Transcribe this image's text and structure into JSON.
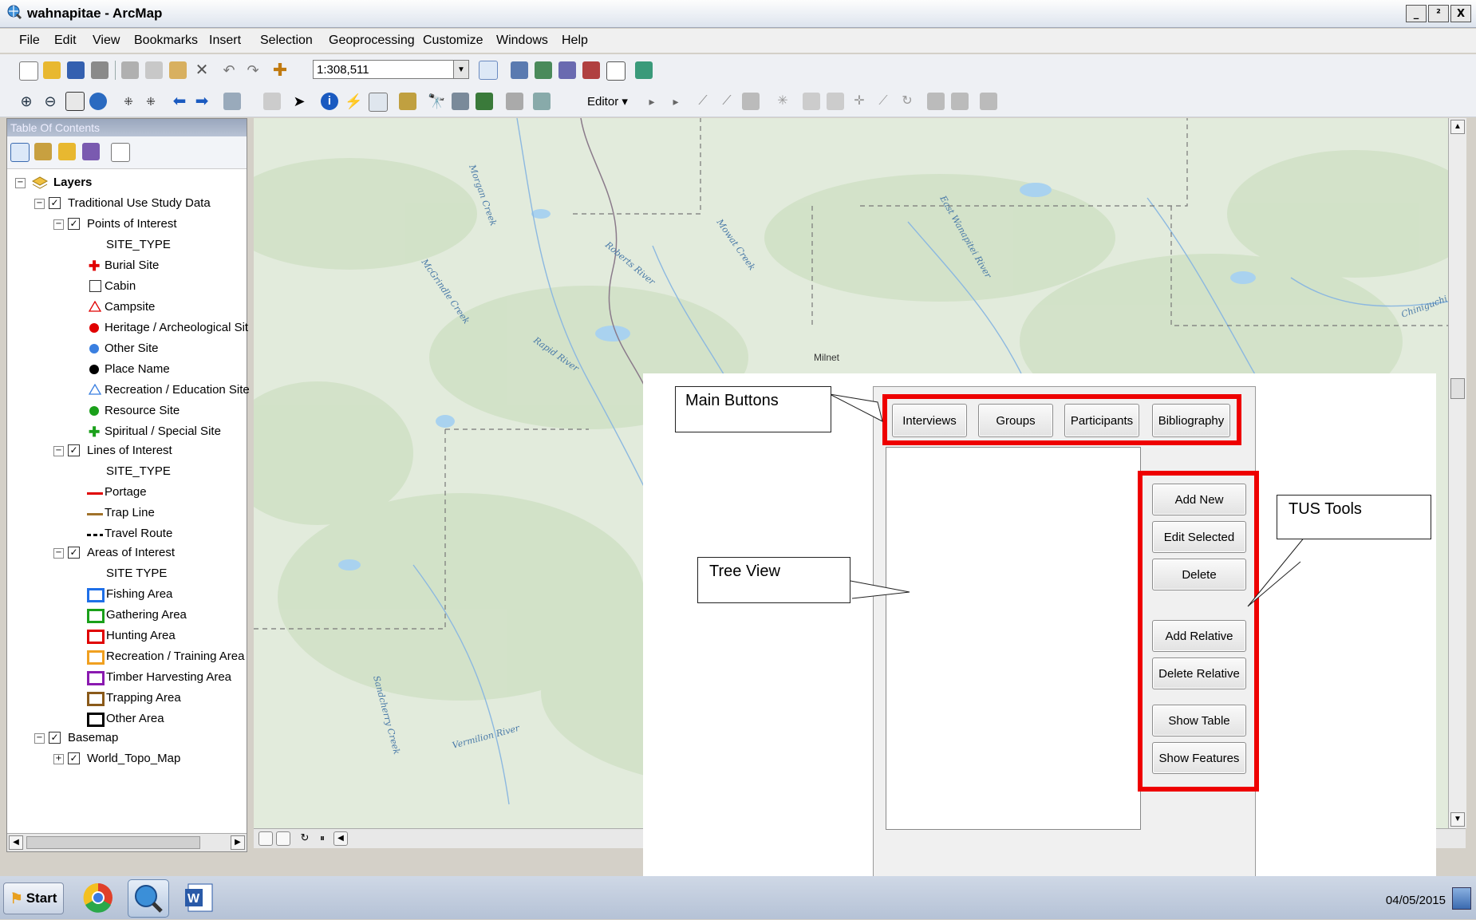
{
  "window": {
    "title": "wahnapitae - ArcMap",
    "minimize": "_",
    "restore": "²",
    "close": "X"
  },
  "menu": [
    "File",
    "Edit",
    "View",
    "Bookmarks",
    "Insert",
    "Selection",
    "Geoprocessing",
    "Customize",
    "Windows",
    "Help"
  ],
  "toolbar": {
    "scale": "1:308,511",
    "editor_label": "Editor ▾"
  },
  "toc": {
    "title": "Table Of Contents",
    "layers_label": "Layers",
    "group_tus": "Traditional Use Study Data",
    "poi": {
      "label": "Points of Interest",
      "field": "SITE_TYPE",
      "items": [
        "Burial Site",
        "Cabin",
        "Campsite",
        "Heritage / Archeological Sit",
        "Other Site",
        "Place Name",
        "Recreation / Education Site",
        "Resource Site",
        "Spiritual / Special Site"
      ]
    },
    "loi": {
      "label": "Lines of Interest",
      "field": "SITE_TYPE",
      "items": [
        "Portage",
        "Trap Line",
        "Travel Route"
      ]
    },
    "aoi": {
      "label": "Areas of Interest",
      "field": "SITE TYPE",
      "items": [
        "Fishing Area",
        "Gathering Area",
        "Hunting Area",
        "Recreation / Training Area",
        "Timber Harvesting Area",
        "Trapping Area",
        "Other Area"
      ]
    },
    "basemap": {
      "label": "Basemap",
      "child": "World_Topo_Map"
    }
  },
  "colors": {
    "burial": "#e00000",
    "heritage": "#e00000",
    "other_site": "#3a7fe0",
    "place_name": "#000000",
    "recreation_edu": "#3a7fe0",
    "resource": "#1aa01a",
    "spiritual": "#1aa01a",
    "campsite": "#e00000",
    "portage": "#e00000",
    "trap_line": "#a0722a",
    "travel_route": "#000000",
    "fishing": "#1e6fe8",
    "gathering": "#1aa01a",
    "hunting": "#e00000",
    "recreation_train": "#f0a020",
    "timber": "#8a1ab0",
    "trapping": "#8a5a1a",
    "other_area": "#000000",
    "highlight": "#ee0000"
  },
  "map_labels": [
    "Morgan Creek",
    "McGrindle Creek",
    "Roberts River",
    "Mowat Creek",
    "East Wanapitei River",
    "Milnet",
    "Rapid River",
    "Chiniguchi",
    "Sandcherry Creek",
    "Vermilion River"
  ],
  "panel": {
    "main_buttons": [
      "Interviews",
      "Groups",
      "Participants",
      "Bibliography"
    ],
    "tools": [
      "Add New",
      "Edit Selected",
      "Delete",
      "Add Relative",
      "Delete Relative",
      "Show Table",
      "Show Features"
    ]
  },
  "callouts": {
    "main_buttons": "Main Buttons",
    "tree_view": "Tree View",
    "tus_tools": "TUS Tools"
  },
  "taskbar": {
    "start": "Start",
    "date": "04/05/2015"
  }
}
